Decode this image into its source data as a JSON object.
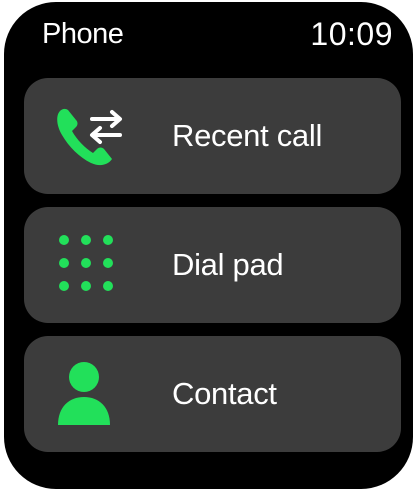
{
  "status_bar": {
    "app_title": "Phone",
    "time": "10:09"
  },
  "menu": {
    "items": [
      {
        "label": "Recent call",
        "icon": "recent-call-icon"
      },
      {
        "label": "Dial pad",
        "icon": "dial-pad-icon"
      },
      {
        "label": "Contact",
        "icon": "contact-icon"
      }
    ]
  },
  "colors": {
    "accent": "#22e05a",
    "card": "#3c3c3c",
    "background": "#000000",
    "text": "#ffffff"
  }
}
